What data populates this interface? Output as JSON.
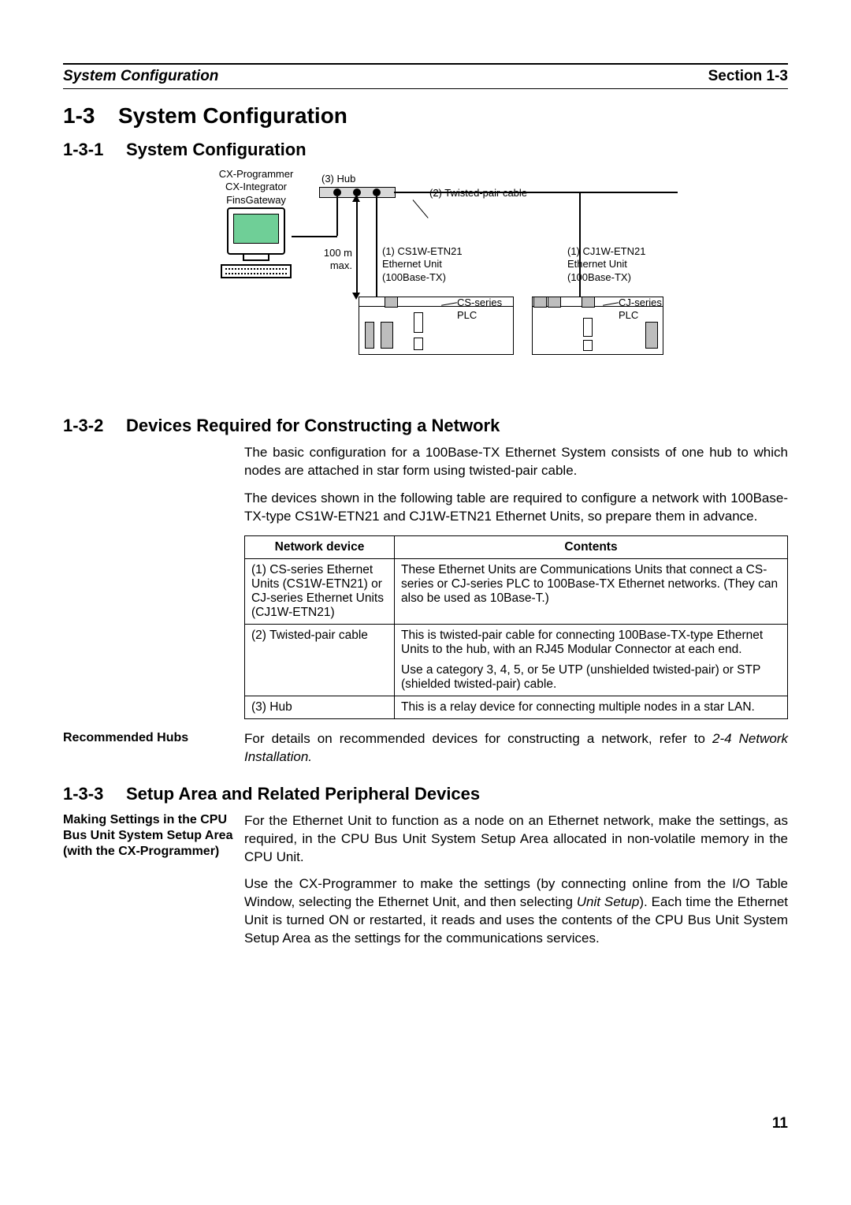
{
  "header": {
    "left": "System Configuration",
    "right": "Section 1-3"
  },
  "h1": {
    "num": "1-3",
    "title": "System Configuration"
  },
  "h2a": {
    "num": "1-3-1",
    "title": "System Configuration"
  },
  "diagram": {
    "software": {
      "l1": "CX-Programmer",
      "l2": "CX-Integrator",
      "l3": "FinsGateway"
    },
    "hub_label": "(3) Hub",
    "cable_label": "(2) Twisted-pair cable",
    "distance": {
      "l1": "100 m",
      "l2": "max."
    },
    "unit_cs": {
      "l1": "(1) CS1W-ETN21",
      "l2": "Ethernet Unit",
      "l3": "(100Base-TX)"
    },
    "unit_cj": {
      "l1": "(1) CJ1W-ETN21",
      "l2": "Ethernet Unit",
      "l3": "(100Base-TX)"
    },
    "plc_cs": {
      "l1": "CS-series",
      "l2": "PLC"
    },
    "plc_cj": {
      "l1": "CJ-series",
      "l2": "PLC"
    }
  },
  "h2b": {
    "num": "1-3-2",
    "title": "Devices Required for Constructing a Network"
  },
  "intro": {
    "p1": "The basic configuration for a 100Base-TX Ethernet System consists of one hub to which nodes are attached in star form using twisted-pair cable.",
    "p2": "The devices shown in the following table are required to configure a network with 100Base-TX-type CS1W-ETN21 and CJ1W-ETN21 Ethernet Units, so prepare them in advance."
  },
  "table": {
    "head": {
      "c1": "Network device",
      "c2": "Contents"
    },
    "rows": [
      {
        "c1": "(1) CS-series Ethernet Units (CS1W-ETN21) or CJ-series Ethernet Units (CJ1W-ETN21)",
        "c2": "These Ethernet Units are Communications Units that connect a CS-series or CJ-series PLC to 100Base-TX Ethernet networks. (They can also be used as 10Base-T.)"
      },
      {
        "c1": "(2) Twisted-pair cable",
        "c2a": "This is twisted-pair cable for connecting 100Base-TX-type Ethernet Units to the hub, with an RJ45 Modular Connector at each end.",
        "c2b": "Use a category 3, 4, 5, or 5e UTP (unshielded twisted-pair) or STP (shielded twisted-pair) cable."
      },
      {
        "c1": "(3) Hub",
        "c2": "This is a relay device for connecting multiple nodes in a star LAN."
      }
    ]
  },
  "rec_hubs": {
    "label": "Recommended Hubs",
    "text": "For details on recommended devices for constructing a network, refer to ",
    "ref": "2-4 Network Installation."
  },
  "h2c": {
    "num": "1-3-3",
    "title": "Setup Area and Related Peripheral Devices"
  },
  "setup": {
    "label": "Making Settings in the CPU Bus Unit System Setup Area (with the CX-Programmer)",
    "p1": "For the Ethernet Unit to function as a node on an Ethernet network, make the settings, as required, in the CPU Bus Unit System Setup Area allocated in non-volatile memory in the CPU Unit.",
    "p2a": "Use the CX-Programmer to make the settings (by connecting online from the I/O Table Window, selecting the Ethernet Unit, and then selecting ",
    "p2b": "Unit Setup",
    "p2c": "). Each time the Ethernet Unit is turned ON or restarted, it reads and uses the contents of the CPU Bus Unit System Setup Area as the settings for the communications services."
  },
  "page_number": "11"
}
